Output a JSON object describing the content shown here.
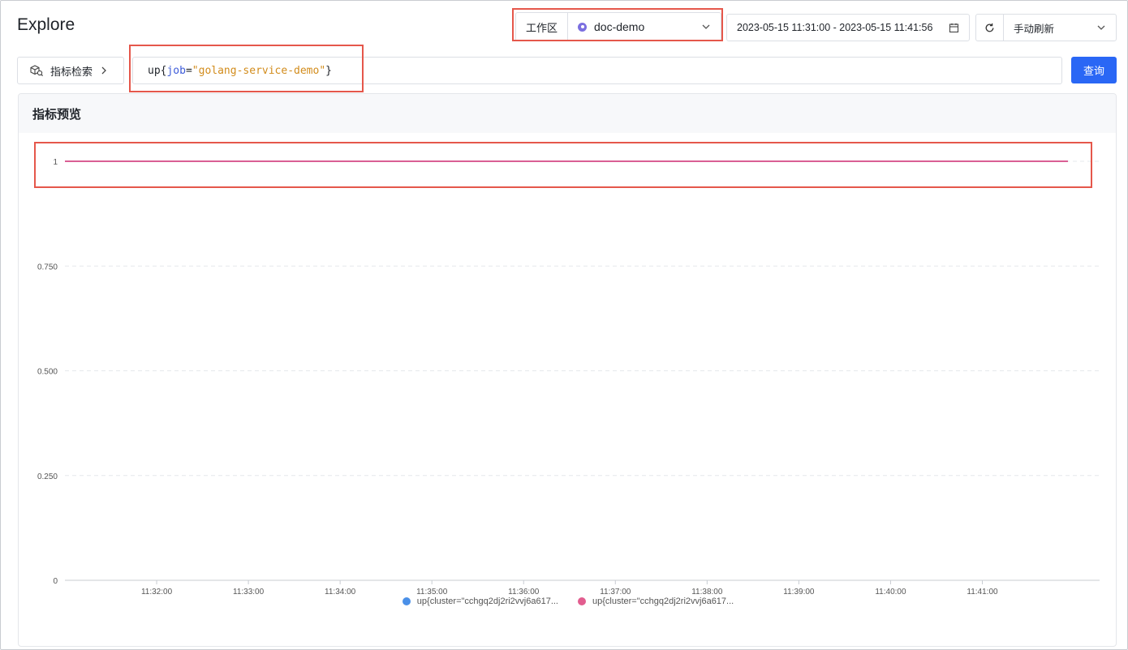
{
  "page": {
    "title": "Explore"
  },
  "workspace": {
    "label": "工作区",
    "value": "doc-demo"
  },
  "time_range": {
    "value": "2023-05-15 11:31:00 - 2023-05-15 11:41:56"
  },
  "refresh": {
    "mode": "手动刷新"
  },
  "metric_search": {
    "label": "指标检索"
  },
  "query": {
    "fn": "up",
    "open": "{",
    "key": "job",
    "eq": "=",
    "str": "\"golang-service-demo\"",
    "close": "}"
  },
  "query_button": {
    "label": "查询"
  },
  "panel": {
    "title": "指标预览"
  },
  "colors": {
    "series_1": "#4a90e8",
    "series_2": "#e25d8f",
    "accent": "#2a67f5",
    "highlight": "#e5574b"
  },
  "chart_data": {
    "type": "line",
    "title": "",
    "xlabel": "",
    "ylabel": "",
    "ylim": [
      0,
      1
    ],
    "y_ticks": [
      "0",
      "0.250",
      "0.500",
      "0.750",
      "1"
    ],
    "x_ticks": [
      "11:32:00",
      "11:33:00",
      "11:34:00",
      "11:35:00",
      "11:36:00",
      "11:37:00",
      "11:38:00",
      "11:39:00",
      "11:40:00",
      "11:41:00"
    ],
    "x": [
      "11:31:00",
      "11:41:56"
    ],
    "grid": true,
    "legend": "bottom-center",
    "series": [
      {
        "name": "up{cluster=\"cchgq2dj2ri2vvj6a617...",
        "values": [
          1,
          1
        ]
      },
      {
        "name": "up{cluster=\"cchgq2dj2ri2vvj6a617...",
        "values": [
          1,
          1
        ]
      }
    ]
  }
}
